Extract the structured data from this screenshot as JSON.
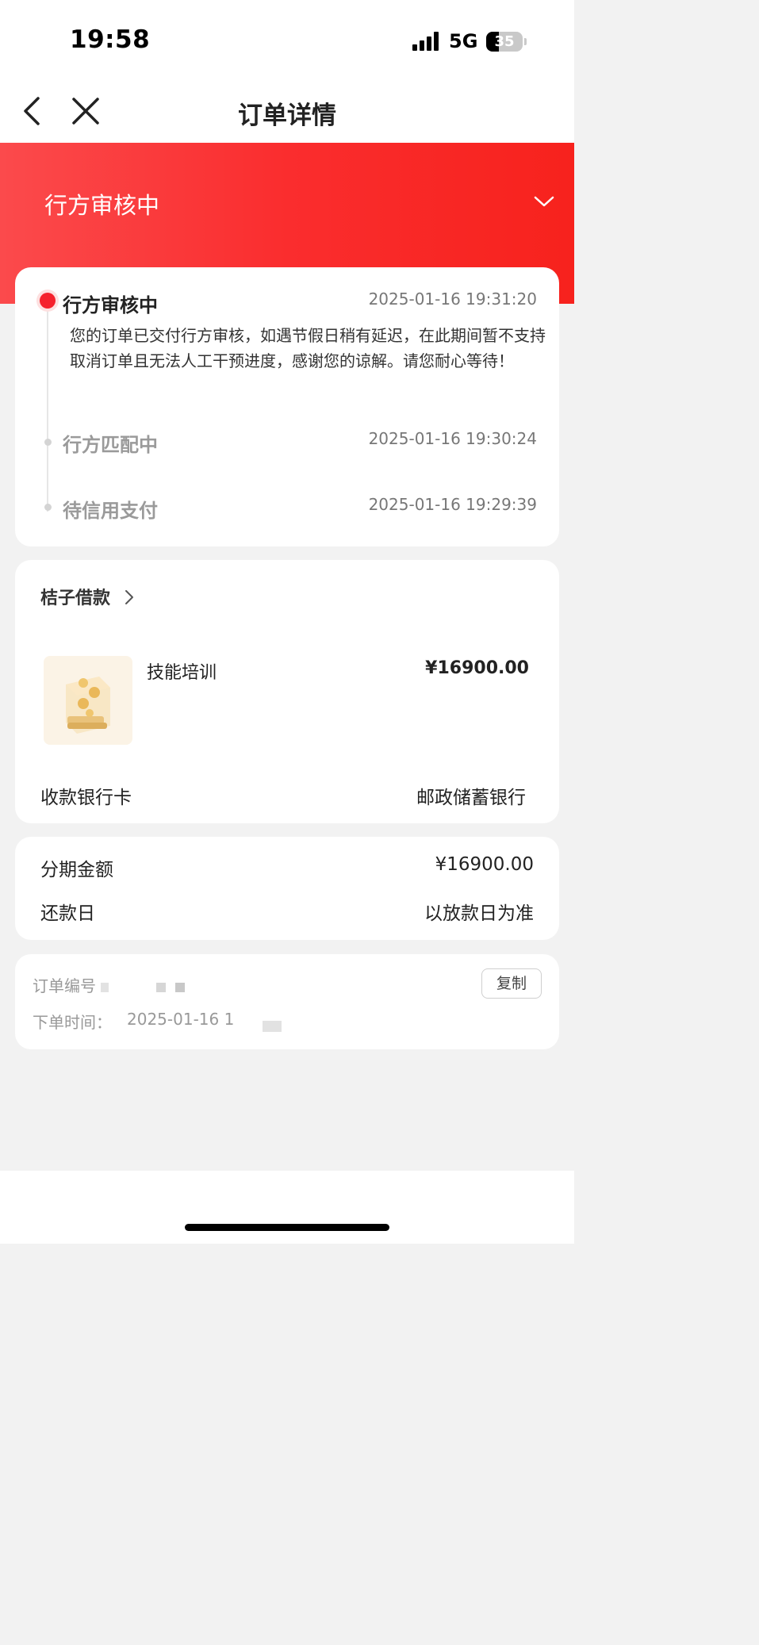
{
  "status_bar": {
    "time": "19:58",
    "network": "5G",
    "battery": "35"
  },
  "nav": {
    "title": "订单详情"
  },
  "hero": {
    "status_title": "行方审核中"
  },
  "timeline": {
    "steps": [
      {
        "label": "行方审核中",
        "time": "2025-01-16 19:31:20",
        "desc": "您的订单已交付行方审核，如遇节假日稍有延迟，在此期间暂不支持取消订单且无法人工干预进度，感谢您的谅解。请您耐心等待！"
      },
      {
        "label": "行方匹配中",
        "time": "2025-01-16 19:30:24"
      },
      {
        "label": "待信用支付",
        "time": "2025-01-16 19:29:39"
      }
    ]
  },
  "product_card": {
    "merchant": "桔子借款",
    "product_name": "技能培训",
    "price": "¥16900.00",
    "bank_label": "收款银行卡",
    "bank_value": "邮政储蓄银行"
  },
  "installment_card": {
    "amount_label": "分期金额",
    "amount_value": "¥16900.00",
    "repay_label": "还款日",
    "repay_value": "以放款日为准"
  },
  "order_card": {
    "order_no_label": "订单编号",
    "order_time_label": "下单时间：",
    "order_time_value": "2025-01-16 1",
    "copy_label": "复制"
  },
  "colors": {
    "accent": "#fa2d2e",
    "text": "#222222",
    "muted": "#999999"
  },
  "icons": [
    "back-icon",
    "close-icon",
    "chevron-down-icon",
    "chevron-right-icon",
    "coin-box-icon",
    "signal-icon",
    "battery-icon"
  ]
}
